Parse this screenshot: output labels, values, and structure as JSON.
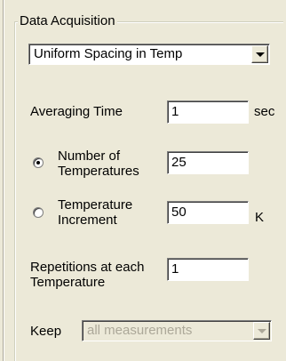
{
  "group": {
    "title": "Data Acquisition"
  },
  "spacing_select": {
    "value": "Uniform Spacing in Temp"
  },
  "averaging_time": {
    "label": "Averaging Time",
    "value": "1",
    "unit": "sec"
  },
  "num_temperatures": {
    "label_line1": "Number of",
    "label_line2": "Temperatures",
    "value": "25",
    "selected": true
  },
  "temp_increment": {
    "label_line1": "Temperature",
    "label_line2": "Increment",
    "value": "50",
    "unit": "K",
    "selected": false
  },
  "repetitions": {
    "label_line1": "Repetitions at each",
    "label_line2": "Temperature",
    "value": "1"
  },
  "keep": {
    "label": "Keep",
    "value": "all measurements",
    "disabled": true
  }
}
